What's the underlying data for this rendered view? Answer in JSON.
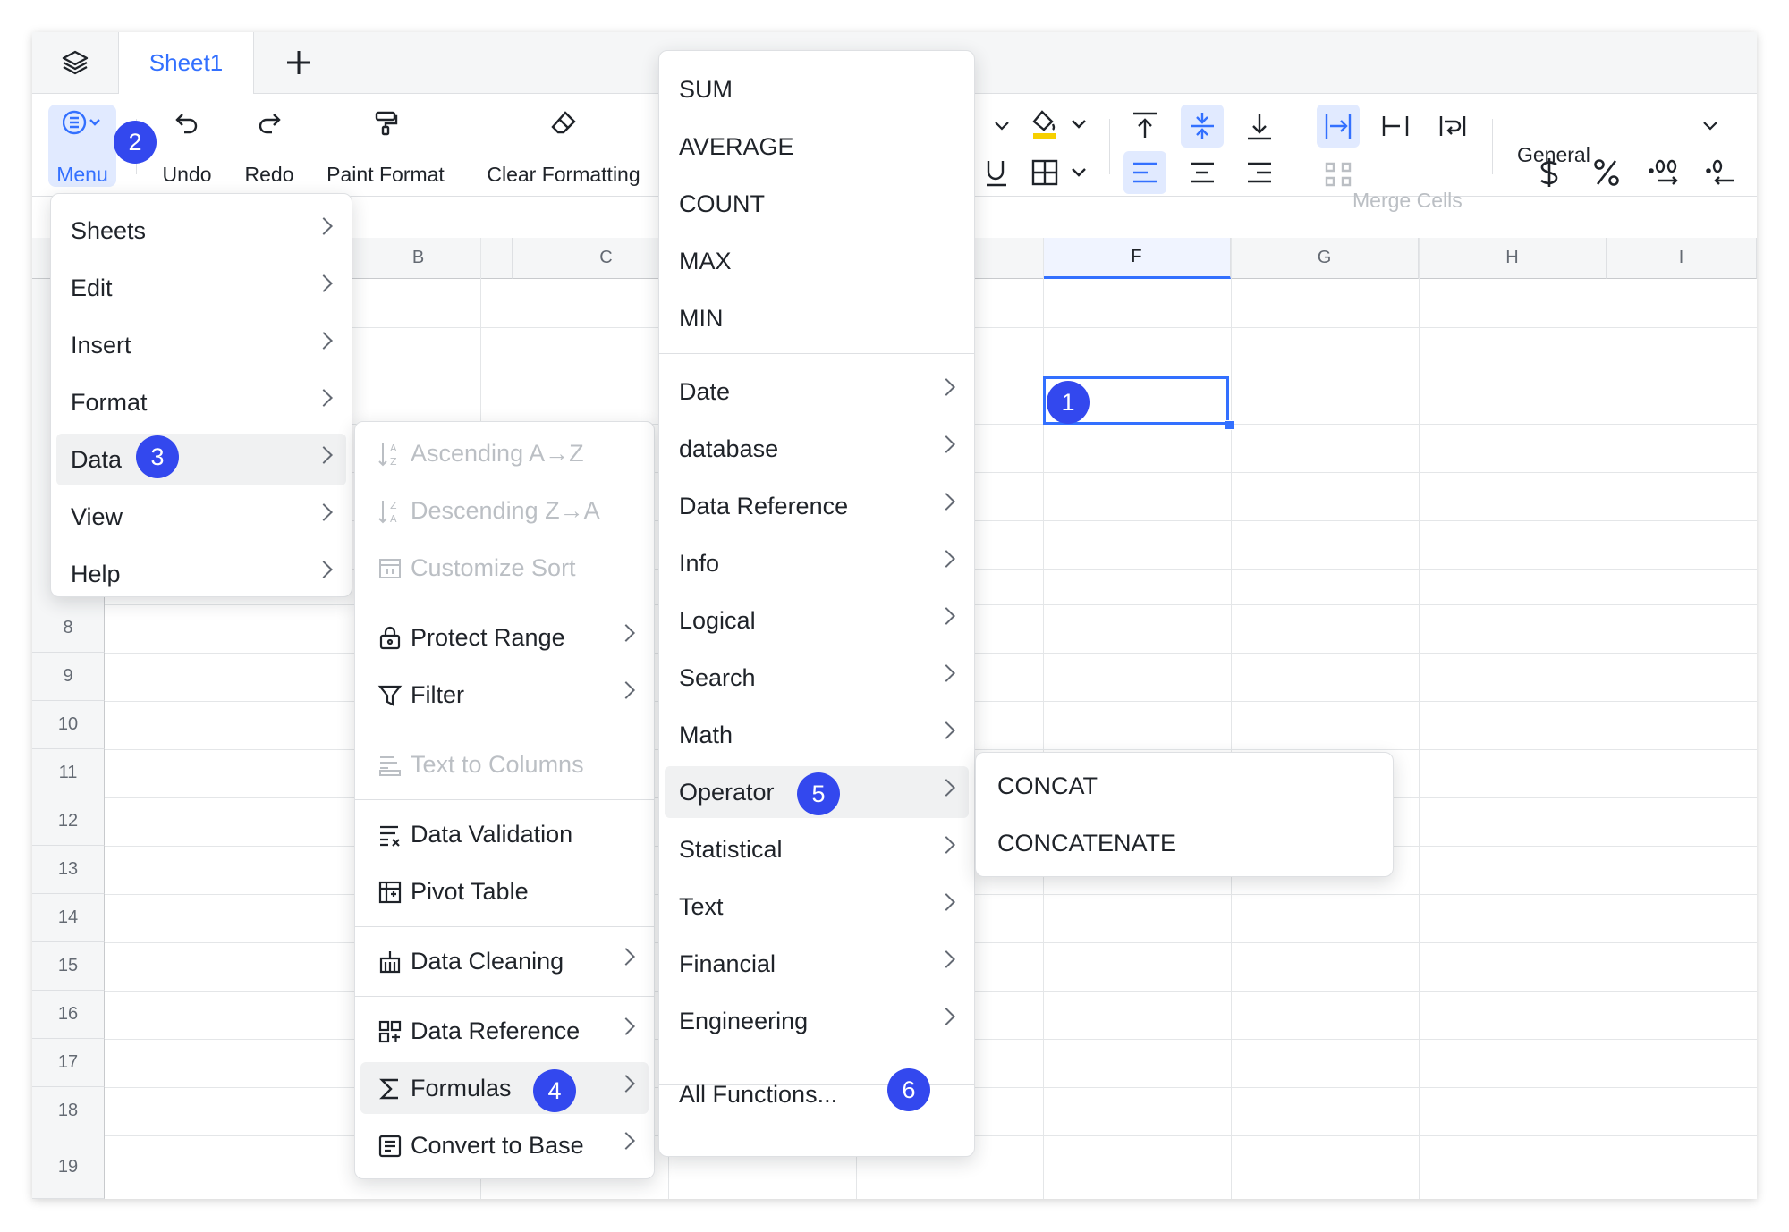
{
  "tabs": {
    "active": "Sheet1"
  },
  "toolbar": {
    "menu": "Menu",
    "undo": "Undo",
    "redo": "Redo",
    "paint_format": "Paint Format",
    "clear_formatting": "Clear Formatting",
    "merge_cells": "Merge Cells",
    "number_format": "General"
  },
  "grid": {
    "columns": [
      "B",
      "C",
      "F",
      "G",
      "H",
      "I"
    ],
    "rows": [
      "8",
      "9",
      "10",
      "11",
      "12",
      "13",
      "14",
      "15",
      "16",
      "17",
      "18",
      "19"
    ],
    "selected_column": "F"
  },
  "main_menu": {
    "items": [
      "Sheets",
      "Edit",
      "Insert",
      "Format",
      "Data",
      "View",
      "Help"
    ]
  },
  "data_menu": {
    "ascending": "Ascending A→Z",
    "descending": "Descending Z→A",
    "customize_sort": "Customize Sort",
    "protect_range": "Protect Range",
    "filter": "Filter",
    "text_to_columns": "Text to Columns",
    "data_validation": "Data Validation",
    "pivot_table": "Pivot Table",
    "data_cleaning": "Data Cleaning",
    "data_reference": "Data Reference",
    "formulas": "Formulas",
    "convert_to_base": "Convert to Base"
  },
  "formula_menu": {
    "quick": [
      "SUM",
      "AVERAGE",
      "COUNT",
      "MAX",
      "MIN"
    ],
    "categories": [
      "Date",
      "database",
      "Data Reference",
      "Info",
      "Logical",
      "Search",
      "Math",
      "Operator",
      "Statistical",
      "Text",
      "Financial",
      "Engineering"
    ],
    "all_functions": "All Functions..."
  },
  "operator_menu": {
    "items": [
      "CONCAT",
      "CONCATENATE"
    ]
  },
  "badges": {
    "b1": "1",
    "b2": "2",
    "b3": "3",
    "b4": "4",
    "b5": "5",
    "b6": "6"
  },
  "colors": {
    "accent": "#3370ff",
    "badge": "#3348ee",
    "disabled": "#bbbfc4"
  }
}
